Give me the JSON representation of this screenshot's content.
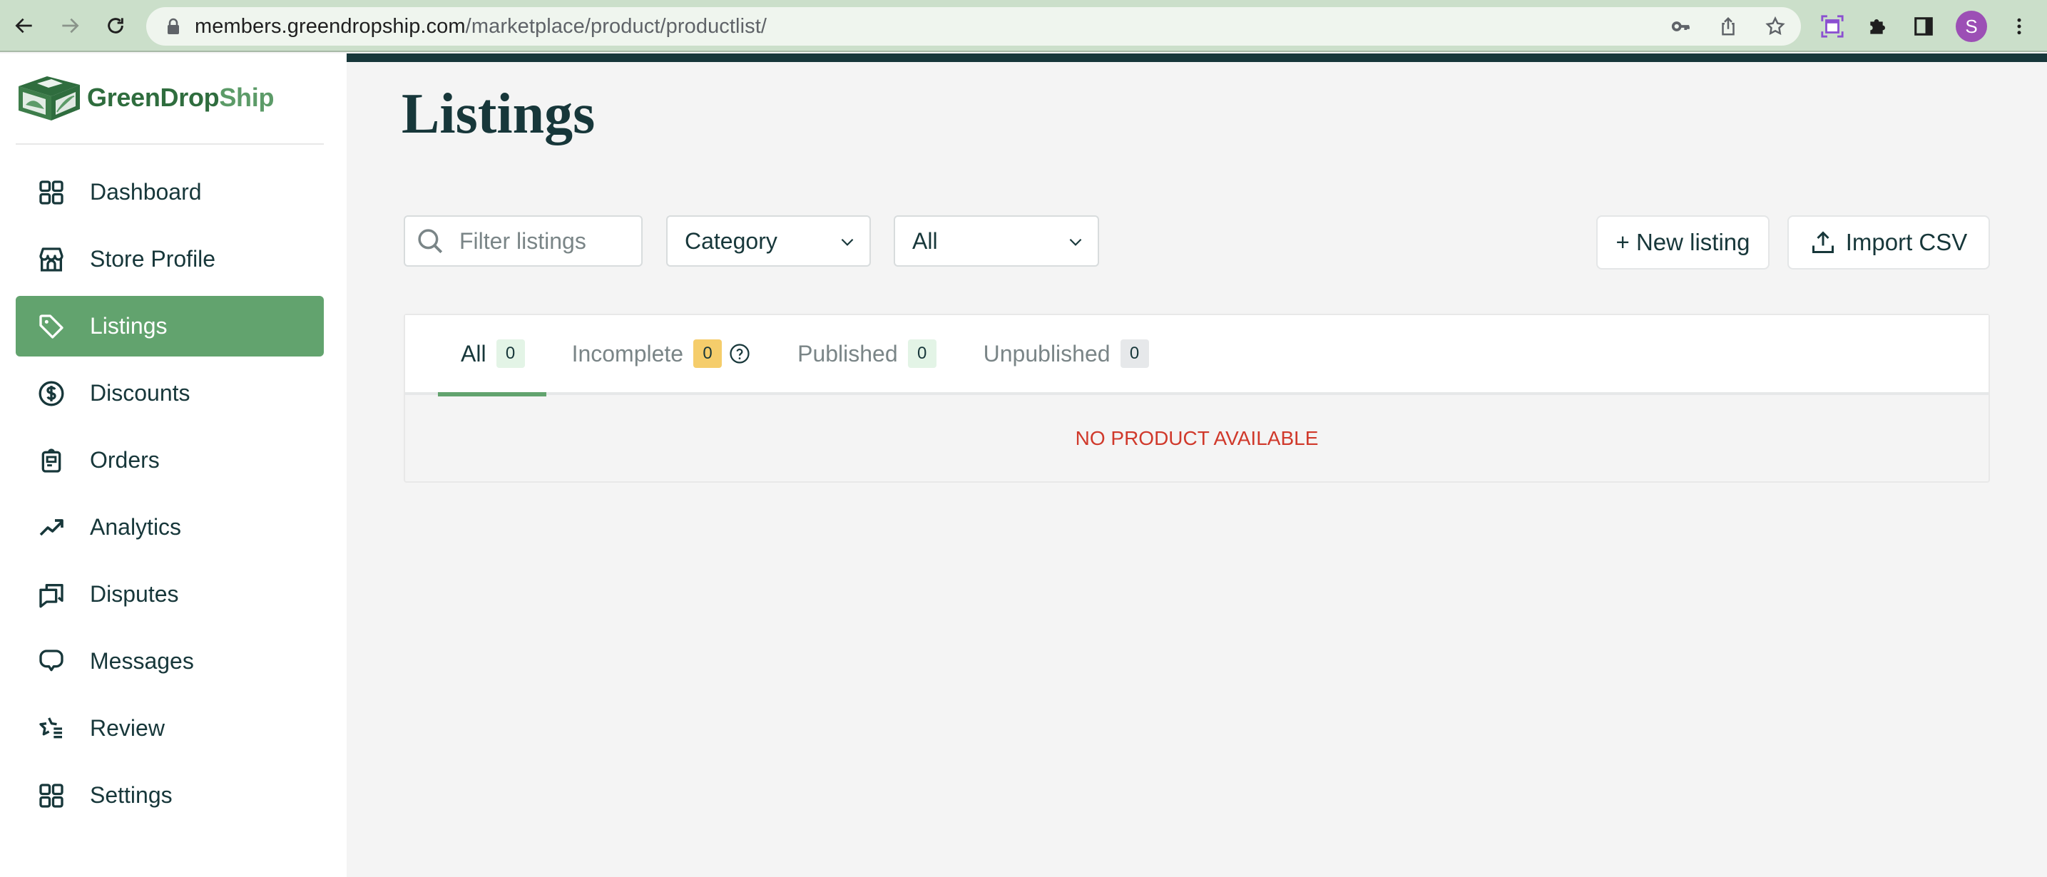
{
  "browser": {
    "url_domain": "members.greendropship.com",
    "url_path": "/marketplace/product/productlist/",
    "profile_initial": "S",
    "icons": [
      "back-arrow-icon",
      "forward-arrow-icon",
      "reload-icon",
      "lock-icon",
      "key-icon",
      "share-icon",
      "star-icon",
      "screen-capture-icon",
      "extensions-icon",
      "side-panel-icon",
      "avatar",
      "kebab-menu-icon"
    ]
  },
  "brand": {
    "name_part1": "GreenDrop",
    "name_part2": "Ship",
    "primary_color": "#62a36e",
    "dark_color": "#17373a"
  },
  "sidebar": {
    "items": [
      {
        "label": "Dashboard",
        "icon": "grid-icon",
        "active": false
      },
      {
        "label": "Store Profile",
        "icon": "store-icon",
        "active": false
      },
      {
        "label": "Listings",
        "icon": "tag-icon",
        "active": true
      },
      {
        "label": "Discounts",
        "icon": "dollar-circle-icon",
        "active": false
      },
      {
        "label": "Orders",
        "icon": "clipboard-icon",
        "active": false
      },
      {
        "label": "Analytics",
        "icon": "trending-up-icon",
        "active": false
      },
      {
        "label": "Disputes",
        "icon": "chat-bubbles-icon",
        "active": false
      },
      {
        "label": "Messages",
        "icon": "message-bubble-icon",
        "active": false
      },
      {
        "label": "Review",
        "icon": "star-list-icon",
        "active": false
      },
      {
        "label": "Settings",
        "icon": "grid-icon",
        "active": false
      }
    ]
  },
  "main": {
    "title": "Listings",
    "search": {
      "placeholder": "Filter listings",
      "value": ""
    },
    "category_select": {
      "selected": "Category"
    },
    "status_select": {
      "selected": "All"
    },
    "new_listing_label": "+ New listing",
    "import_csv_label": "Import CSV",
    "tabs": [
      {
        "label": "All",
        "count": "0",
        "badge_color": "#e3f4e6",
        "active": true
      },
      {
        "label": "Incomplete",
        "count": "0",
        "badge_color": "#f5cd6b",
        "active": false,
        "has_help": true
      },
      {
        "label": "Published",
        "count": "0",
        "badge_color": "#e3f4e6",
        "active": false
      },
      {
        "label": "Unpublished",
        "count": "0",
        "badge_color": "#e6e8ea",
        "active": false
      }
    ],
    "empty_message": "NO PRODUCT AVAILABLE"
  }
}
